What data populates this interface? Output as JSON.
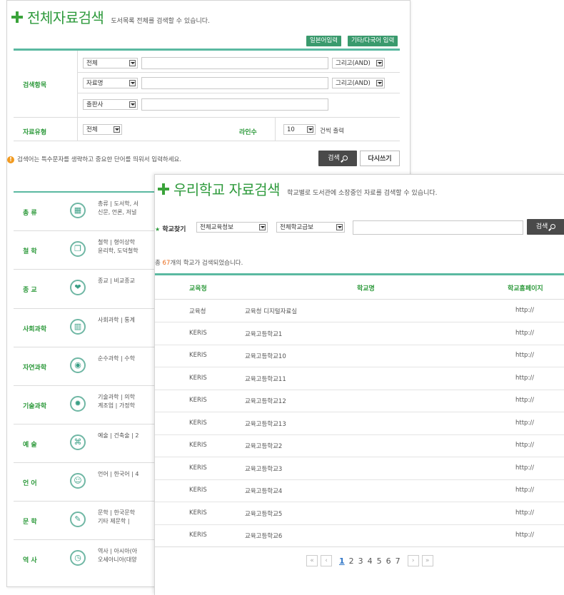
{
  "search_window": {
    "title": "전체자료검색",
    "description": "도서목록 전체를 검색할 수 있습니다.",
    "buttons": {
      "japanese": "일본어입력",
      "other_lang": "기타/다국어 입력"
    },
    "search_items_label": "검색항목",
    "rows": [
      {
        "field": "전체",
        "op": "그리고(AND)"
      },
      {
        "field": "자료명",
        "op": "그리고(AND)"
      },
      {
        "field": "출판사"
      }
    ],
    "type_label": "자료유형",
    "type_value": "전체",
    "lines_label": "라인수",
    "lines_value": "10",
    "lines_suffix": "건씩 출력",
    "notice": "검색어는 특수문자를 생략하고 중요한 단어를 띄워서 입력하세요.",
    "search_button": "검색",
    "reset_button": "다시쓰기",
    "categories": [
      {
        "label": "총 류",
        "line1": "총류 | 도서학, 서",
        "line2": "신문, 언론, 저널",
        "icon": "calculator-icon",
        "glyph": "▦"
      },
      {
        "label": "철 학",
        "line1": "철학 | 형이상학",
        "line2": "윤리학, 도덕철학",
        "icon": "book-icon",
        "glyph": "❐"
      },
      {
        "label": "종 교",
        "line1": "종교 | 비교종교",
        "line2": "",
        "icon": "heart-icon",
        "glyph": "❤"
      },
      {
        "label": "사회과학",
        "line1": "사회과학 | 통계",
        "line2": "",
        "icon": "bar-chart-icon",
        "glyph": "▥"
      },
      {
        "label": "자연과학",
        "line1": "순수과학 | 수학",
        "line2": "",
        "icon": "globe-icon",
        "glyph": "◉"
      },
      {
        "label": "기술과학",
        "line1": "기술과학 | 의학",
        "line2": "계조업 | 가정학",
        "icon": "gear-icon",
        "glyph": "✹"
      },
      {
        "label": "예 술",
        "line1": "예술 | 건축술 | 2",
        "line2": "",
        "icon": "film-camera-icon",
        "glyph": "⌘"
      },
      {
        "label": "언 어",
        "line1": "언어 | 한국어 | 4",
        "line2": "",
        "icon": "speech-head-icon",
        "glyph": "☺"
      },
      {
        "label": "문 학",
        "line1": "문학 | 한국문학",
        "line2": "기타 제문학 |",
        "icon": "pen-icon",
        "glyph": "✎"
      },
      {
        "label": "역 사",
        "line1": "역사 | 아시아(아",
        "line2": "오세아니아(대양",
        "icon": "clock-icon",
        "glyph": "◷"
      }
    ]
  },
  "school_window": {
    "title": "우리학교 자료검색",
    "description": "학교별로 도서관에 소장중인 자료를 검색할 수 있습니다.",
    "finder_label": "학교찾기",
    "office_select": "전체교육청보",
    "level_select": "전체학교급보",
    "search_button": "검색",
    "result_prefix": "총 ",
    "result_count": "67",
    "result_suffix": "개의 학교가 검색되었습니다.",
    "columns": [
      "교육청",
      "학교명",
      "학교홈페이지"
    ],
    "rows": [
      {
        "office": "교육청",
        "school": "교육청 디지털자료실",
        "homepage": "http://"
      },
      {
        "office": "KERIS",
        "school": "교육고등학교1",
        "homepage": "http://"
      },
      {
        "office": "KERIS",
        "school": "교육고등학교10",
        "homepage": "http://"
      },
      {
        "office": "KERIS",
        "school": "교육고등학교11",
        "homepage": "http://"
      },
      {
        "office": "KERIS",
        "school": "교육고등학교12",
        "homepage": "http://"
      },
      {
        "office": "KERIS",
        "school": "교육고등학교13",
        "homepage": "http://"
      },
      {
        "office": "KERIS",
        "school": "교육고등학교2",
        "homepage": "http://"
      },
      {
        "office": "KERIS",
        "school": "교육고등학교3",
        "homepage": "http://"
      },
      {
        "office": "KERIS",
        "school": "교육고등학교4",
        "homepage": "http://"
      },
      {
        "office": "KERIS",
        "school": "교육고등학교5",
        "homepage": "http://"
      },
      {
        "office": "KERIS",
        "school": "교육고등학교6",
        "homepage": "http://"
      }
    ],
    "pagination": {
      "first": "«",
      "prev": "‹",
      "pages": [
        "1",
        "2",
        "3",
        "4",
        "5",
        "6",
        "7"
      ],
      "next": "›",
      "last": "»"
    }
  },
  "colors": {
    "accent_green": "#2e9a3c",
    "teal_rule": "#5bb9a1",
    "link_blue": "#2e75c7",
    "count_orange": "#e86a1a"
  }
}
